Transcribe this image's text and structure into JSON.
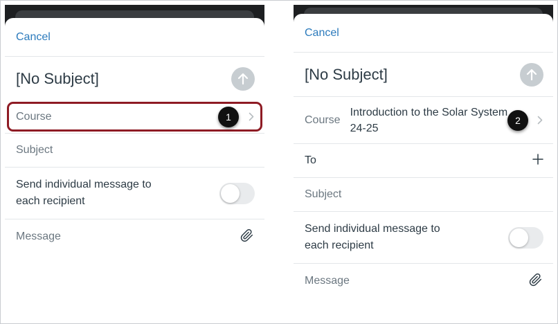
{
  "left": {
    "cancel_label": "Cancel",
    "title": "[No Subject]",
    "course_label": "Course",
    "subject_label": "Subject",
    "individual_label": "Send individual message to each recipient",
    "message_label": "Message",
    "badge": "1",
    "individual_enabled": false
  },
  "right": {
    "cancel_label": "Cancel",
    "title": "[No Subject]",
    "course_label": "Course",
    "course_value": "Introduction to the Solar System 24-25",
    "to_label": "To",
    "subject_label": "Subject",
    "individual_label": "Send individual message to each recipient",
    "message_label": "Message",
    "badge": "2",
    "individual_enabled": false
  },
  "icons": {
    "send": "arrow-up-icon",
    "chevron": "chevron-right-icon",
    "add": "plus-icon",
    "attachment": "paperclip-icon"
  },
  "colors": {
    "accent": "#2b7abc",
    "highlight_outline": "#8e1b24",
    "send_disabled": "#c7cdd1",
    "text": "#2d3b45",
    "muted_text": "#6b7780"
  }
}
